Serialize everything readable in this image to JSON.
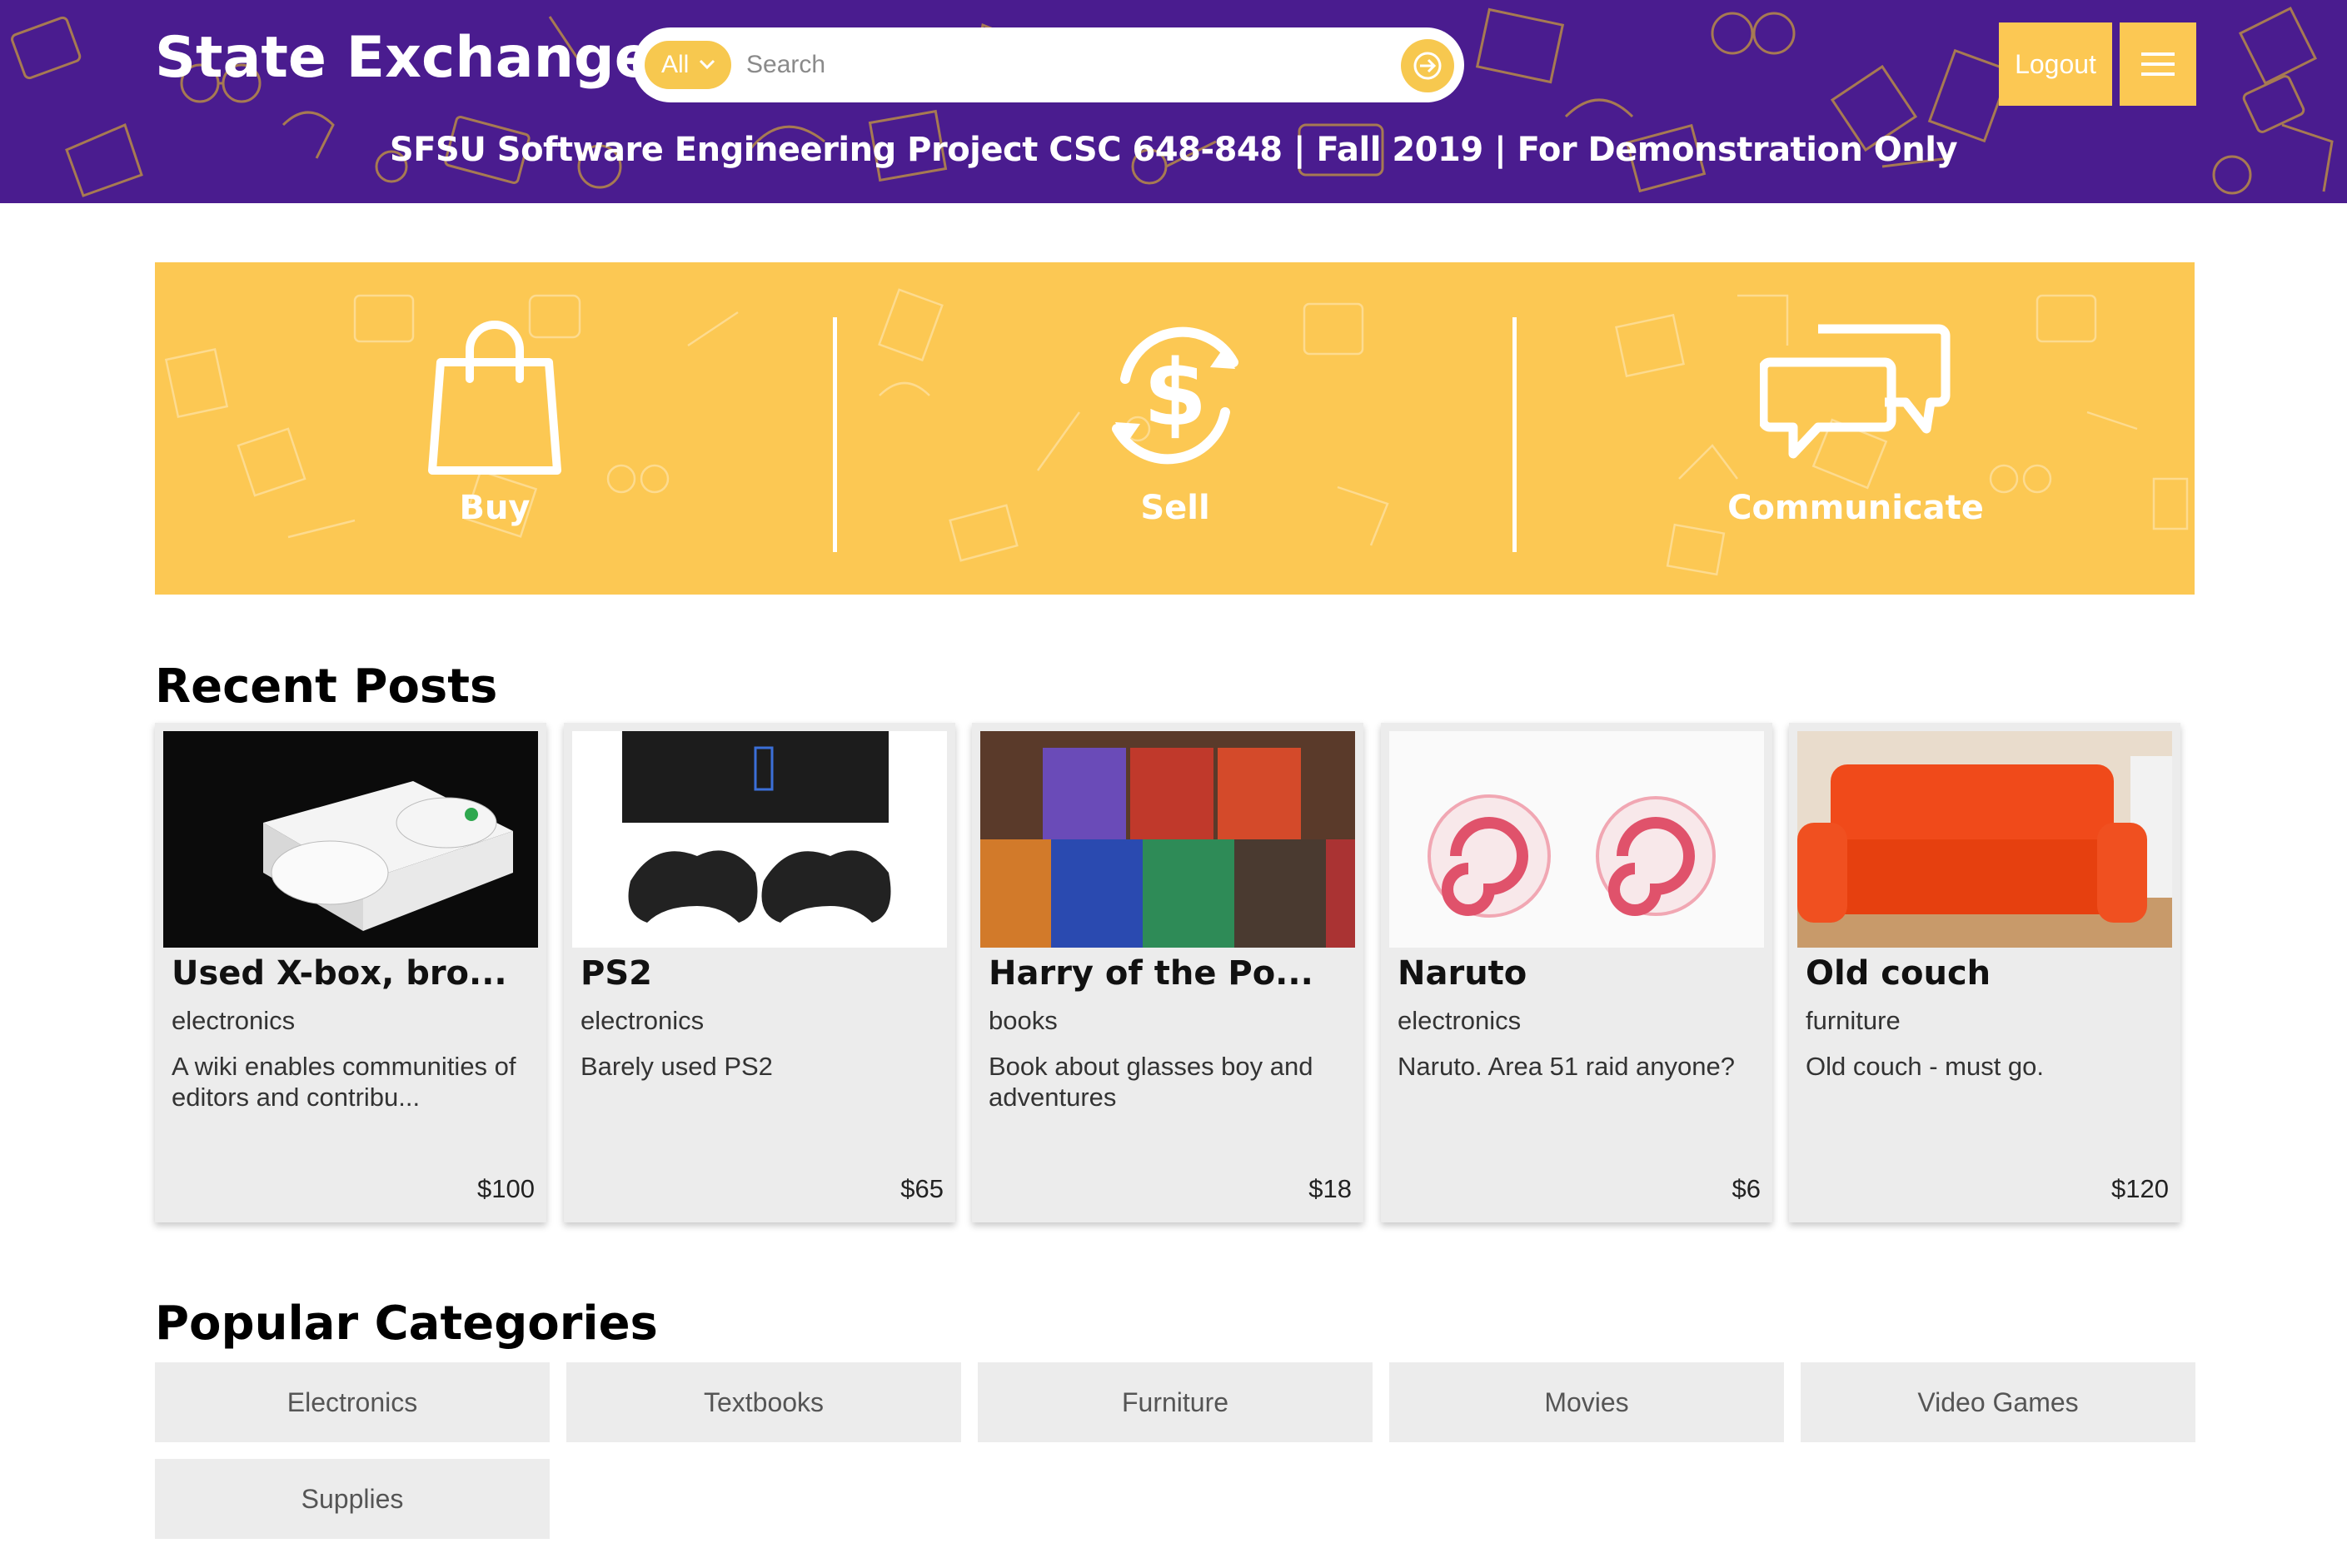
{
  "header": {
    "brand": "State Exchange",
    "search": {
      "category": "All",
      "placeholder": "Search"
    },
    "logout_label": "Logout",
    "subtitle": "SFSU Software Engineering Project CSC 648-848 | Fall 2019 | For Demonstration Only"
  },
  "hero": {
    "items": [
      {
        "label": "Buy",
        "icon": "shopping-bag-icon"
      },
      {
        "label": "Sell",
        "icon": "dollar-cycle-icon"
      },
      {
        "label": "Communicate",
        "icon": "chat-bubbles-icon"
      }
    ]
  },
  "recent": {
    "title": "Recent Posts",
    "posts": [
      {
        "title": "Used X-box, bro...",
        "category": "electronics",
        "description": "A wiki enables communities of editors and contribu...",
        "price": "$100"
      },
      {
        "title": "PS2",
        "category": "electronics",
        "description": "Barely used PS2",
        "price": "$65"
      },
      {
        "title": "Harry of the Po...",
        "category": "books",
        "description": "Book about glasses boy and adventures",
        "price": "$18"
      },
      {
        "title": "Naruto",
        "category": "electronics",
        "description": "Naruto. Area 51 raid anyone?",
        "price": "$6"
      },
      {
        "title": "Old couch",
        "category": "furniture",
        "description": "Old couch - must go.",
        "price": "$120"
      }
    ]
  },
  "categories": {
    "title": "Popular Categories",
    "items": [
      "Electronics",
      "Textbooks",
      "Furniture",
      "Movies",
      "Video Games",
      "Supplies"
    ]
  },
  "colors": {
    "header_bg": "#4a1c8f",
    "accent": "#fcc853",
    "card_bg": "#ececec"
  }
}
